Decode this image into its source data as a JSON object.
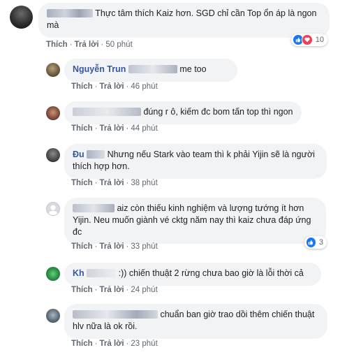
{
  "comments": [
    {
      "text": "Thực tâm thích Kaiz hơn. SGD chỉ cần Top ổn áp là ngon mà",
      "like": "Thích",
      "reply": "Trả lời",
      "time": "50 phút",
      "reactions": "10"
    },
    {
      "name": "Nguyễn Trun",
      "text": "me too",
      "like": "Thích",
      "reply": "Trả lời",
      "time": "46 phút"
    },
    {
      "text": "đúng r ô, kiếm đc bom tấn top thì ngon",
      "like": "Thích",
      "reply": "Trả lời",
      "time": "44 phút"
    },
    {
      "name": "Đu",
      "text": "Nhưng nếu Stark vào team thì k phải Yijin sẽ là người thích hợp hơn.",
      "like": "Thích",
      "reply": "Trả lời",
      "time": "38 phút"
    },
    {
      "text": "aiz còn thiếu kinh nghiệm và lượng tướng ít hơn Yijin. Neu muốn giành vé cktg năm nay thì kaiz chưa đáp ứng đc",
      "like": "Thích",
      "reply": "Trả lời",
      "time": "33 phút",
      "reactions": "3"
    },
    {
      "name": "Kh",
      "text": ":)) chiến thuật 2 rừng chưa bao giờ là lỗi thời cả",
      "like": "Thích",
      "reply": "Trả lời",
      "time": "24 phút"
    },
    {
      "text": "chuẩn ban giờ trao dồi thêm chiến thuật hlv nữa là ok rồi.",
      "like": "Thích",
      "reply": "Trả lời",
      "time": "23 phút"
    }
  ],
  "icons": {
    "like": "thumbs-up-icon",
    "love": "heart-icon"
  },
  "colors": {
    "like_blue": "#1877f2",
    "love_red": "#f33e58",
    "bubble": "#f2f3f5",
    "meta": "#606770"
  }
}
